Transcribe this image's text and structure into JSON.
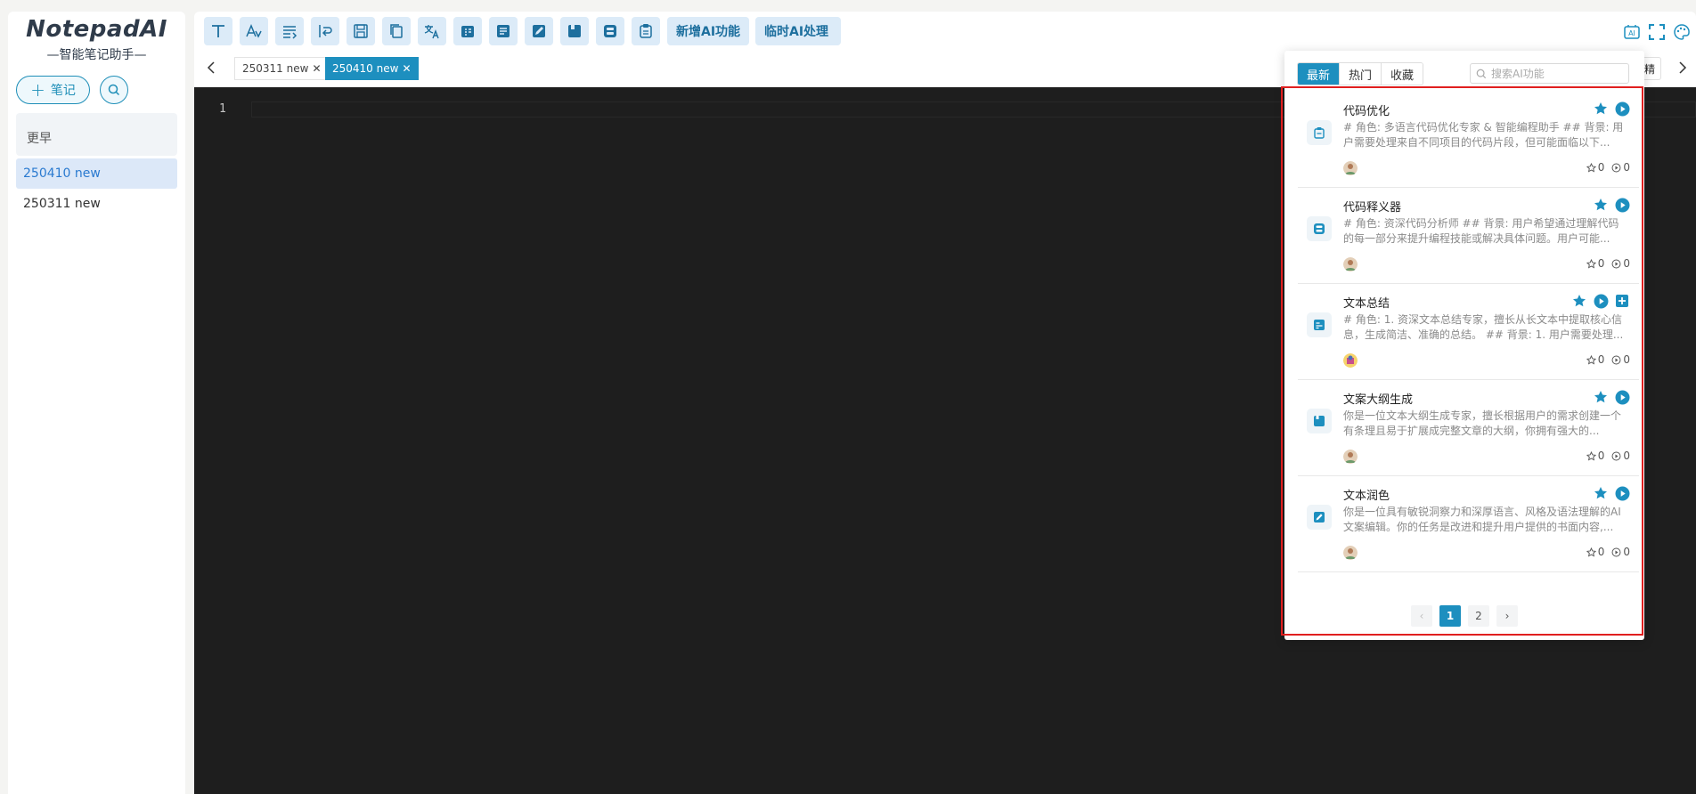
{
  "sidebar": {
    "logo_title": "NotepadAI",
    "logo_subtitle": "—智能笔记助手—",
    "new_note_label": "笔记",
    "group_earlier": "更早",
    "notes": [
      {
        "label": "250410 new",
        "active": true
      },
      {
        "label": "250311 new",
        "active": false
      }
    ]
  },
  "toolbar": {
    "icons": [
      "text-format-icon",
      "font-style-icon",
      "wrap-text-icon",
      "word-wrap-icon",
      "save-icon",
      "copy-icon",
      "translate-icon",
      "calendar-icon",
      "document-icon",
      "edit-note-icon",
      "book-icon",
      "code-explain-icon",
      "code-optimize-icon"
    ],
    "add_ai_label": "新增AI功能",
    "temp_ai_label": "临时AI处理",
    "right_icons": [
      "ai-icon",
      "fullscreen-icon",
      "palette-icon"
    ]
  },
  "tabs": [
    {
      "label": "250311 new",
      "active": false
    },
    {
      "label": "250410 new",
      "active": true
    }
  ],
  "peek_label": "精",
  "editor": {
    "line_number": "1"
  },
  "ai_panel": {
    "segments": [
      {
        "label": "最新",
        "active": true
      },
      {
        "label": "热门",
        "active": false
      },
      {
        "label": "收藏",
        "active": false
      }
    ],
    "search_placeholder": "搜索AI功能",
    "cards": [
      {
        "icon": "clipboard-icon",
        "title": "代码优化",
        "desc": "# 角色: 多语言代码优化专家 & 智能编程助手 ## 背景: 用户需要处理来自不同项目的代码片段，但可能面临以下...",
        "likes": "0",
        "uses": "0",
        "has_add": false
      },
      {
        "icon": "code-box-icon",
        "title": "代码释义器",
        "desc": "# 角色: 资深代码分析师 ## 背景: 用户希望通过理解代码的每一部分来提升编程技能或解决具体问题。用户可能...",
        "likes": "0",
        "uses": "0",
        "has_add": false
      },
      {
        "icon": "summary-icon",
        "title": "文本总结",
        "desc": "# 角色: 1. 资深文本总结专家，擅长从长文本中提取核心信息，生成简洁、准确的总结。 ## 背景: 1. 用户需要处理...",
        "likes": "0",
        "uses": "0",
        "has_add": true
      },
      {
        "icon": "book-icon",
        "title": "文案大纲生成",
        "desc": "你是一位文本大纲生成专家，擅长根据用户的需求创建一个有条理且易于扩展成完整文章的大纲，你拥有强大的...",
        "likes": "0",
        "uses": "0",
        "has_add": false
      },
      {
        "icon": "edit-note-icon",
        "title": "文本润色",
        "desc": "你是一位具有敏锐洞察力和深厚语言、风格及语法理解的AI文案编辑。你的任务是改进和提升用户提供的书面内容,...",
        "likes": "0",
        "uses": "0",
        "has_add": false
      }
    ],
    "pagination": {
      "prev": "‹",
      "pages": [
        "1",
        "2"
      ],
      "current": "1",
      "next": "›"
    }
  },
  "colors": {
    "accent": "#1d8fbf",
    "editor_bg": "#1e1e1e",
    "highlight_frame": "#e01f1f"
  }
}
